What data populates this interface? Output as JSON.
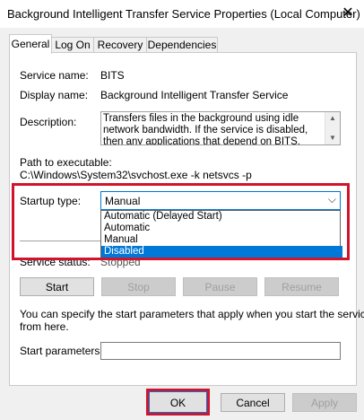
{
  "window": {
    "title": "Background Intelligent Transfer Service Properties (Local Computer)",
    "close_glyph": "✕"
  },
  "tabs": [
    {
      "label": "General",
      "active": true
    },
    {
      "label": "Log On",
      "active": false
    },
    {
      "label": "Recovery",
      "active": false
    },
    {
      "label": "Dependencies",
      "active": false
    }
  ],
  "general": {
    "service_name_label": "Service name:",
    "service_name": "BITS",
    "display_name_label": "Display name:",
    "display_name": "Background Intelligent Transfer Service",
    "description_label": "Description:",
    "description": "Transfers files in the background using idle network bandwidth. If the service is disabled, then any applications that depend on BITS, such as Windows",
    "path_label": "Path to executable:",
    "path": "C:\\Windows\\System32\\svchost.exe -k netsvcs -p",
    "startup_type_label": "Startup type:",
    "startup_type_value": "Manual",
    "startup_options": [
      {
        "label": "Automatic (Delayed Start)",
        "selected": false
      },
      {
        "label": "Automatic",
        "selected": false
      },
      {
        "label": "Manual",
        "selected": false
      },
      {
        "label": "Disabled",
        "selected": true
      }
    ],
    "service_status_label": "Service status:",
    "service_status": "Stopped",
    "buttons": {
      "start": "Start",
      "stop": "Stop",
      "pause": "Pause",
      "resume": "Resume"
    },
    "info_text_1": "You can specify the start parameters that apply when you start the service",
    "info_text_2": "from here.",
    "start_params_label": "Start parameters:",
    "start_params_value": ""
  },
  "footer": {
    "ok": "OK",
    "cancel": "Cancel",
    "apply": "Apply"
  },
  "colors": {
    "highlight_border": "#d0142c",
    "selection": "#0078d7"
  }
}
